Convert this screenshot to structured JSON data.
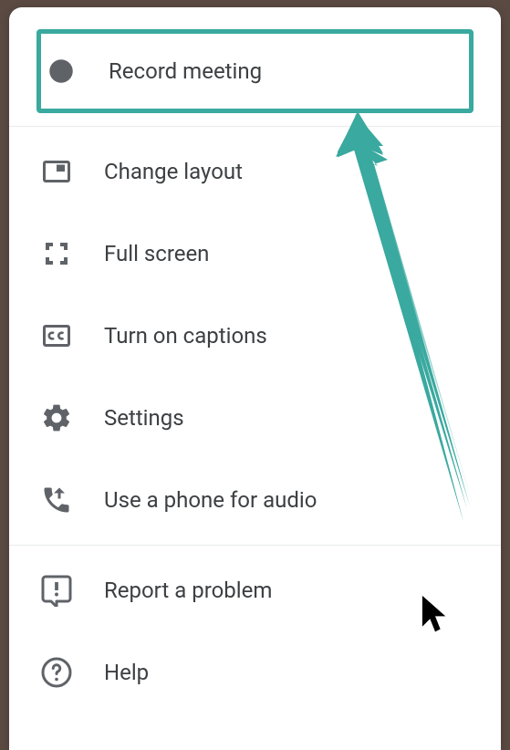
{
  "menu": {
    "record": {
      "label": "Record meeting"
    },
    "layout": {
      "label": "Change layout"
    },
    "fullscreen": {
      "label": "Full screen"
    },
    "captions": {
      "label": "Turn on captions"
    },
    "settings": {
      "label": "Settings"
    },
    "phone": {
      "label": "Use a phone for audio"
    },
    "report": {
      "label": "Report a problem"
    },
    "help": {
      "label": "Help"
    }
  },
  "annotation": {
    "highlight_color": "#3aa99f"
  }
}
